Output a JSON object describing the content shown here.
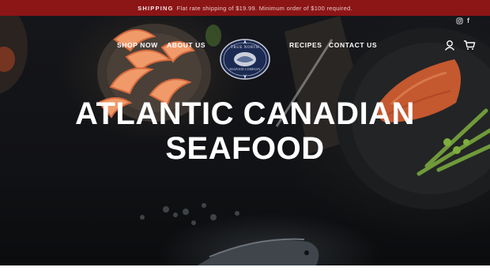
{
  "announcement": {
    "label": "SHIPPING",
    "text": "Flat rate shipping of $19.99. Minimum order of $100 required."
  },
  "nav": {
    "shop_now": "SHOP NOW",
    "about_us": "ABOUT US",
    "recipes": "RECIPES",
    "contact_us": "CONTACT US"
  },
  "logo": {
    "line1": "TRUE NORTH",
    "line2": "SEAFOOD COMPANY"
  },
  "hero": {
    "title_line1": "ATLANTIC CANADIAN",
    "title_line2": "SEAFOOD"
  },
  "icons": {
    "social": [
      "instagram-icon",
      "facebook-icon"
    ],
    "header": [
      "account-icon",
      "cart-icon"
    ]
  },
  "colors": {
    "announcement_bg": "#8c1516",
    "text": "#ffffff",
    "background": "#111215"
  }
}
